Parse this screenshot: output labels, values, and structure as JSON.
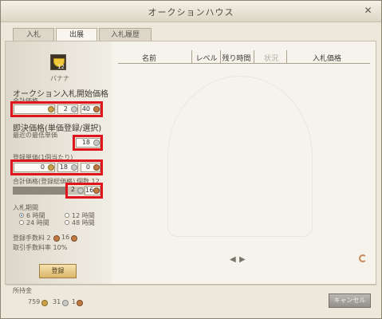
{
  "window": {
    "title": "オークションハウス",
    "close_icon": "x-icon"
  },
  "tabs": [
    {
      "label": "入札",
      "active": false
    },
    {
      "label": "出展",
      "active": true
    },
    {
      "label": "入札履歴",
      "active": false
    }
  ],
  "item": {
    "name": "バナナ",
    "stack_count": "12",
    "icon": "banana-icon"
  },
  "start_price": {
    "heading": "オークション入札開始価格",
    "total_label": "合計価格",
    "gold": "",
    "silver": "2",
    "copper": "40"
  },
  "buyout": {
    "heading": "即決価格(単価登録/選択)",
    "recent_label": "最近の最低単価",
    "recent_value": "18"
  },
  "unit_price": {
    "label": "登録単価(1個当たり)",
    "gold": "0",
    "silver": "18",
    "copper": "0"
  },
  "total_registered": {
    "label": "合計価格(登録総価格)",
    "count_label": "個数 12",
    "silver": "2",
    "copper": "16",
    "quantity_fill": 1.0
  },
  "duration": {
    "label": "入札期間",
    "options": [
      {
        "label": "6 時間",
        "selected": true
      },
      {
        "label": "12 時間",
        "selected": false
      },
      {
        "label": "24 時間",
        "selected": false
      },
      {
        "label": "48 時間",
        "selected": false
      }
    ]
  },
  "fees": {
    "registration_label": "登録手数料 2",
    "registration_copper": "16",
    "commission_label": "取引手数料率 10%"
  },
  "register_button": "登録",
  "listing_table": {
    "columns": [
      "名前",
      "レベル",
      "残り時間",
      "状況",
      "入札価格"
    ]
  },
  "pager": {
    "prev": "◀",
    "next": "▶"
  },
  "footer": {
    "money_label": "所持金",
    "gold": "759",
    "silver": "31",
    "copper": "1"
  },
  "cancel_button": "キャンセル",
  "colors": {
    "highlight": "#e0141c",
    "gold": "#c9a248",
    "silver": "#c9c9c5",
    "copper": "#c27a45"
  }
}
